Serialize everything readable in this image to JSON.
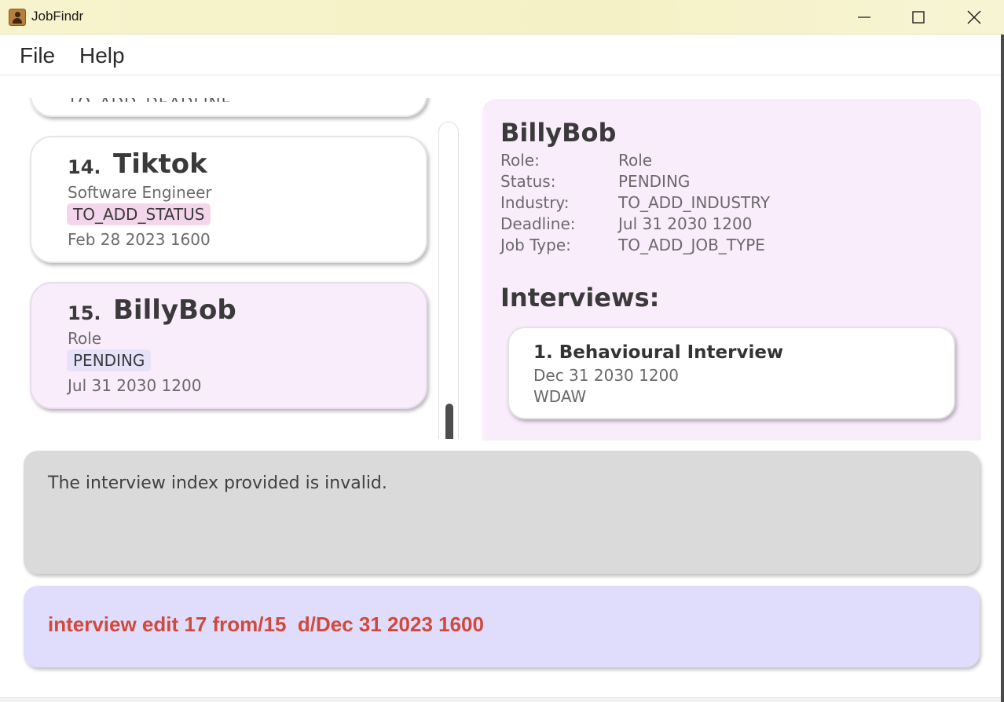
{
  "window": {
    "title": "JobFindr"
  },
  "menu": {
    "items": [
      "File",
      "Help"
    ]
  },
  "job_list": {
    "partial_card_text": "TO_ADD_DEADLINE",
    "cards": [
      {
        "index": "14.",
        "name": "Tiktok",
        "role": "Software Engineer",
        "status": "TO_ADD_STATUS",
        "status_color": "#f3d6ec",
        "deadline": "Feb 28 2023 1600"
      },
      {
        "index": "15.",
        "name": "BillyBob",
        "role": "Role",
        "status": "PENDING",
        "status_color": "#e6e2fa",
        "deadline": "Jul 31 2030 1200",
        "selected": true
      }
    ]
  },
  "detail": {
    "name": "BillyBob",
    "rows": [
      {
        "label": "Role:",
        "value": "Role"
      },
      {
        "label": "Status:",
        "value": "PENDING"
      },
      {
        "label": "Industry:",
        "value": "TO_ADD_INDUSTRY"
      },
      {
        "label": "Deadline:",
        "value": "Jul 31 2030 1200"
      },
      {
        "label": "Job Type:",
        "value": "TO_ADD_JOB_TYPE"
      }
    ],
    "interviews_title": "Interviews:",
    "interviews": [
      {
        "title": "1. Behavioural Interview",
        "date": "Dec 31 2030 1200",
        "note": "WDAW"
      }
    ]
  },
  "result": {
    "message": "The interview index provided is invalid."
  },
  "command": {
    "value": "interview edit 17 from/15  d/Dec 31 2023 1600"
  },
  "colors": {
    "accent_selected": "#f9ecfb",
    "command_text": "#d04a3c",
    "command_bg": "#e0dcfb",
    "result_bg": "#dadada"
  }
}
